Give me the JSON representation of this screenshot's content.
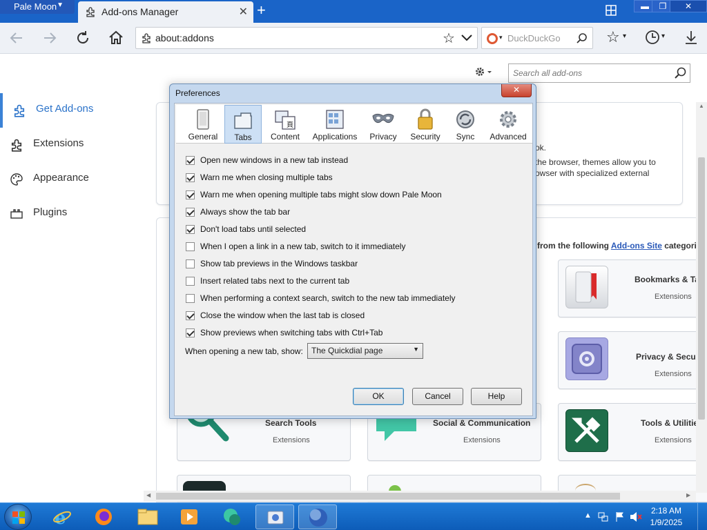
{
  "browser": {
    "menu_label": "Pale Moon",
    "tab_title": "Add-ons Manager",
    "url": "about:addons",
    "search_placeholder": "DuckDuckGo"
  },
  "addons": {
    "search_placeholder": "Search all add-ons",
    "categories": [
      {
        "label": "Get Add-ons",
        "icon": "puzzle-outline-icon"
      },
      {
        "label": "Extensions",
        "icon": "puzzle-icon"
      },
      {
        "label": "Appearance",
        "icon": "palette-icon"
      },
      {
        "label": "Plugins",
        "icon": "plug-icon"
      }
    ],
    "featured_lines": [
      "ok.",
      "the browser, themes allow you to",
      "owser with specialized external"
    ],
    "browse_intro_prefix": "from the following ",
    "browse_intro_link": "Add-ons Site",
    "browse_intro_suffix": " categori",
    "cards": [
      {
        "title": "Bookmarks & Ta",
        "sub": "Extensions",
        "icon": "bookmark-icon"
      },
      {
        "title": "Privacy & Secu",
        "sub": "Extensions",
        "icon": "safe-icon"
      },
      {
        "title": "Search Tools",
        "sub": "Extensions",
        "icon": "magnifier-icon"
      },
      {
        "title": "Social & Communication",
        "sub": "Extensions",
        "icon": "chat-bubble-icon"
      },
      {
        "title": "Tools & Utilitie",
        "sub": "Extensions",
        "icon": "wrench-hammer-icon"
      }
    ]
  },
  "dialog": {
    "title": "Preferences",
    "panes": [
      {
        "label": "General",
        "icon": "general-icon",
        "selected": false
      },
      {
        "label": "Tabs",
        "icon": "tabs-icon",
        "selected": true
      },
      {
        "label": "Content",
        "icon": "content-icon",
        "selected": false
      },
      {
        "label": "Applications",
        "icon": "applications-icon",
        "selected": false
      },
      {
        "label": "Privacy",
        "icon": "privacy-mask-icon",
        "selected": false
      },
      {
        "label": "Security",
        "icon": "security-lock-icon",
        "selected": false
      },
      {
        "label": "Sync",
        "icon": "sync-icon",
        "selected": false
      },
      {
        "label": "Advanced",
        "icon": "advanced-gear-icon",
        "selected": false
      }
    ],
    "options": [
      {
        "label": "Open new windows in a new tab instead",
        "checked": true
      },
      {
        "label": "Warn me when closing multiple tabs",
        "checked": true
      },
      {
        "label": "Warn me when opening multiple tabs might slow down Pale Moon",
        "checked": true
      },
      {
        "label": "Always show the tab bar",
        "checked": true
      },
      {
        "label": "Don't load tabs until selected",
        "checked": true
      },
      {
        "label": "When I open a link in a new tab, switch to it immediately",
        "checked": false
      },
      {
        "label": "Show tab previews in the Windows taskbar",
        "checked": false
      },
      {
        "label": "Insert related tabs next to the current tab",
        "checked": false
      },
      {
        "label": "When performing a context search, switch to the new tab immediately",
        "checked": false
      },
      {
        "label": "Close the window when the last tab is closed",
        "checked": true
      },
      {
        "label": "Show previews when switching tabs with Ctrl+Tab",
        "checked": true
      }
    ],
    "newtab_label": "When opening a new tab, show:",
    "newtab_value": "The Quickdial page",
    "buttons": {
      "ok": "OK",
      "cancel": "Cancel",
      "help": "Help"
    }
  },
  "taskbar": {
    "time": "2:18 AM",
    "date": "1/9/2025",
    "apps": [
      "internet-explorer-icon",
      "firefox-icon",
      "file-explorer-icon",
      "media-player-icon",
      "messenger-icon",
      "media-center-icon",
      "pale-moon-icon"
    ]
  },
  "colors": {
    "accent": "#1a64c8",
    "selected_pane": "#cde0f5",
    "link": "#2a59b8"
  }
}
